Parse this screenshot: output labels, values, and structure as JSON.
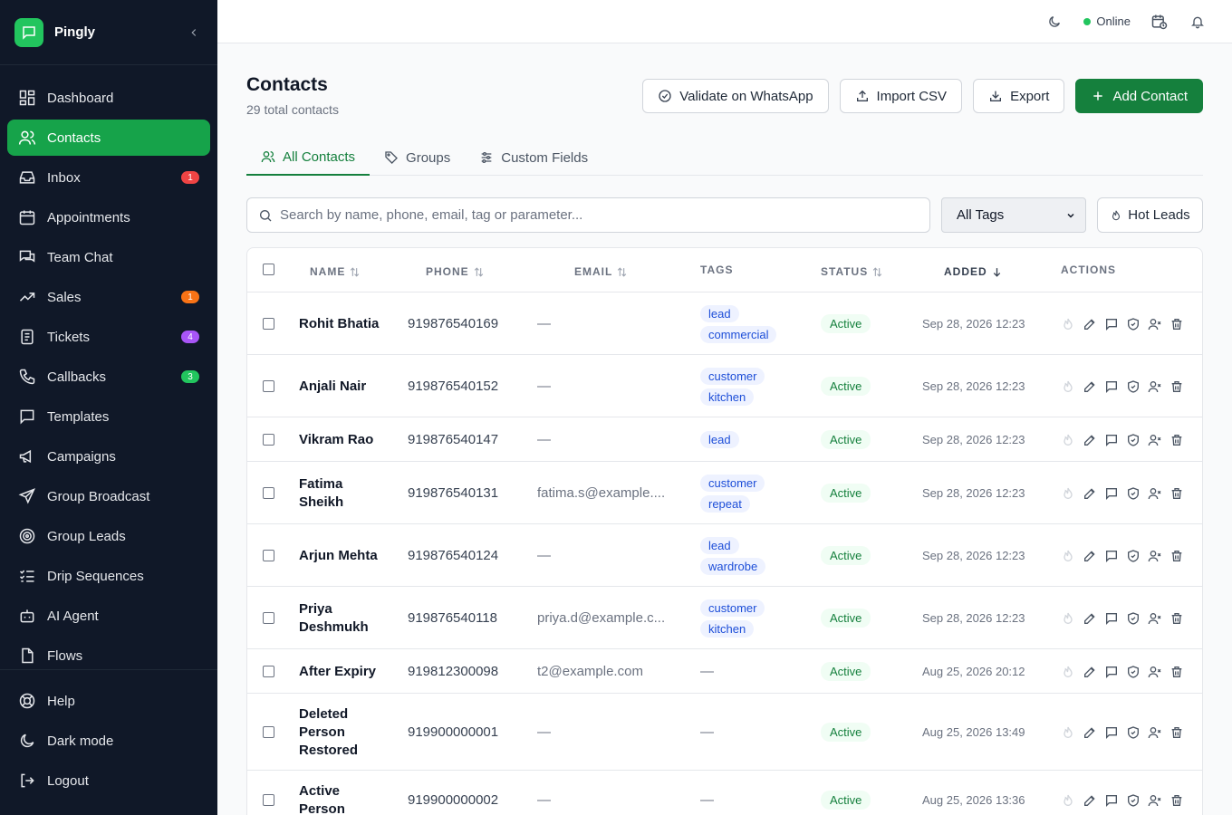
{
  "app": {
    "name": "Pingly"
  },
  "sidebar": {
    "items": [
      {
        "label": "Dashboard",
        "icon": "dashboard-icon",
        "active": false
      },
      {
        "label": "Contacts",
        "icon": "users-icon",
        "active": true
      },
      {
        "label": "Inbox",
        "icon": "inbox-icon",
        "badge": "1",
        "badge_color": "#ef4444"
      },
      {
        "label": "Appointments",
        "icon": "calendar-icon"
      },
      {
        "label": "Team Chat",
        "icon": "chat-icon"
      },
      {
        "label": "Sales",
        "icon": "trend-icon",
        "badge": "1",
        "badge_color": "#f97316"
      },
      {
        "label": "Tickets",
        "icon": "ticket-icon",
        "badge": "4",
        "badge_color": "#a855f7"
      },
      {
        "label": "Callbacks",
        "icon": "phone-icon",
        "badge": "3",
        "badge_color": "#22c55e"
      },
      {
        "label": "Templates",
        "icon": "template-icon"
      },
      {
        "label": "Campaigns",
        "icon": "megaphone-icon"
      },
      {
        "label": "Group Broadcast",
        "icon": "send-icon"
      },
      {
        "label": "Group Leads",
        "icon": "target-icon"
      },
      {
        "label": "Drip Sequences",
        "icon": "list-check-icon"
      },
      {
        "label": "AI Agent",
        "icon": "bot-icon"
      },
      {
        "label": "Flows",
        "icon": "file-icon"
      }
    ],
    "bottom": [
      {
        "label": "Help",
        "icon": "help-icon"
      },
      {
        "label": "Dark mode",
        "icon": "moon-icon"
      },
      {
        "label": "Logout",
        "icon": "logout-icon"
      }
    ]
  },
  "topbar": {
    "status": "Online"
  },
  "page": {
    "title": "Contacts",
    "subtitle": "29 total contacts",
    "buttons": {
      "validate": "Validate on WhatsApp",
      "import": "Import CSV",
      "export": "Export",
      "add": "Add Contact"
    },
    "tabs": [
      "All Contacts",
      "Groups",
      "Custom Fields"
    ],
    "search_placeholder": "Search by name, phone, email, tag or parameter...",
    "tag_filter": "All Tags",
    "hot_leads": "Hot Leads"
  },
  "table": {
    "headers": {
      "name": "NAME",
      "phone": "PHONE",
      "email": "EMAIL",
      "tags": "TAGS",
      "status": "STATUS",
      "added": "ADDED",
      "actions": "ACTIONS"
    },
    "rows": [
      {
        "name": "Rohit Bhatia",
        "phone": "919876540169",
        "email": "—",
        "tags": [
          "lead",
          "commercial"
        ],
        "status": "Active",
        "added": "Sep 28, 2026 12:23"
      },
      {
        "name": "Anjali Nair",
        "phone": "919876540152",
        "email": "—",
        "tags": [
          "customer",
          "kitchen"
        ],
        "status": "Active",
        "added": "Sep 28, 2026 12:23"
      },
      {
        "name": "Vikram Rao",
        "phone": "919876540147",
        "email": "—",
        "tags": [
          "lead"
        ],
        "status": "Active",
        "added": "Sep 28, 2026 12:23"
      },
      {
        "name": "Fatima Sheikh",
        "phone": "919876540131",
        "email": "fatima.s@example....",
        "tags": [
          "customer",
          "repeat"
        ],
        "status": "Active",
        "added": "Sep 28, 2026 12:23"
      },
      {
        "name": "Arjun Mehta",
        "phone": "919876540124",
        "email": "—",
        "tags": [
          "lead",
          "wardrobe"
        ],
        "status": "Active",
        "added": "Sep 28, 2026 12:23"
      },
      {
        "name": "Priya Deshmukh",
        "phone": "919876540118",
        "email": "priya.d@example.c...",
        "tags": [
          "customer",
          "kitchen"
        ],
        "status": "Active",
        "added": "Sep 28, 2026 12:23"
      },
      {
        "name": "After Expiry",
        "phone": "919812300098",
        "email": "t2@example.com",
        "tags": [],
        "status": "Active",
        "added": "Aug 25, 2026 20:12"
      },
      {
        "name": "Deleted Person Restored",
        "phone": "919900000001",
        "email": "—",
        "tags": [],
        "status": "Active",
        "added": "Aug 25, 2026 13:49"
      },
      {
        "name": "Active Person",
        "phone": "919900000002",
        "email": "—",
        "tags": [],
        "status": "Active",
        "added": "Aug 25, 2026 13:36"
      }
    ],
    "empty_value": "—"
  },
  "colors": {
    "accent": "#16a34a",
    "sidebar_bg": "#101828"
  }
}
